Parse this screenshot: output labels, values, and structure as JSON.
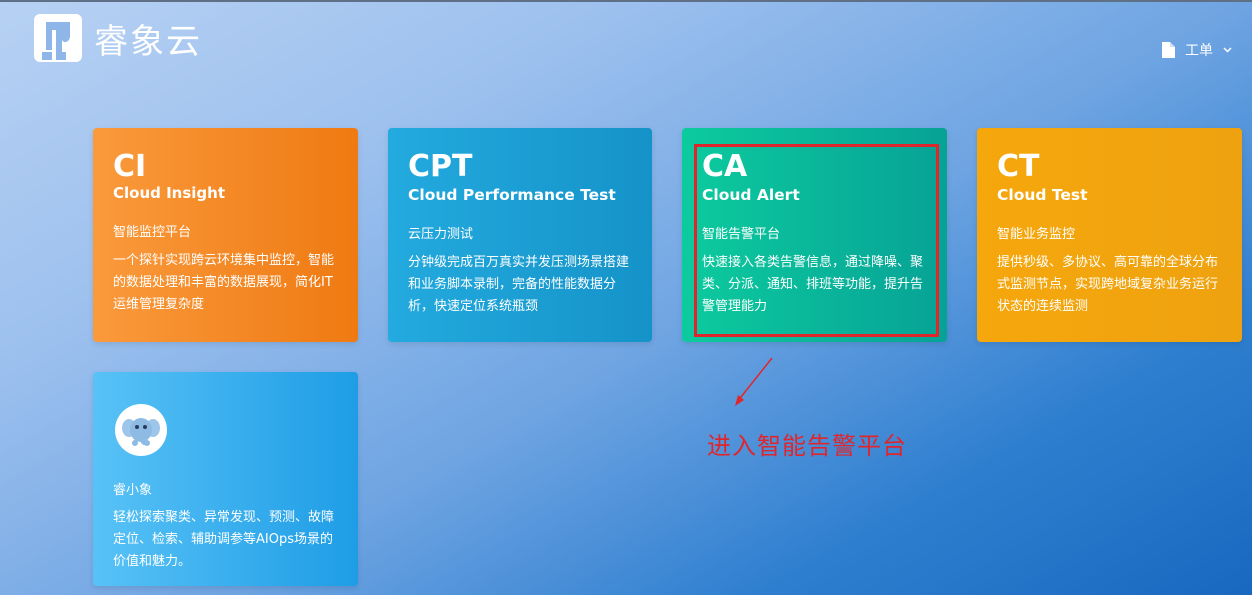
{
  "brand": {
    "name": "睿象云",
    "logo_icon": "elephant-logo-icon"
  },
  "header": {
    "workorder_label": "工单",
    "workorder_icon": "document-icon",
    "chevron_icon": "chevron-down-icon"
  },
  "cards": [
    {
      "abbr": "CI",
      "fullname": "Cloud Insight",
      "subtitle": "智能监控平台",
      "desc": "一个探针实现跨云环境集中监控，智能的数据处理和丰富的数据展现，简化IT运维管理复杂度",
      "color": "#f08a22"
    },
    {
      "abbr": "CPT",
      "fullname": "Cloud Performance Test",
      "subtitle": "云压力测试",
      "desc": "分钟级完成百万真实并发压测场景搭建和业务脚本录制，完备的性能数据分析，快速定位系统瓶颈",
      "color": "#1b9fd4"
    },
    {
      "abbr": "CA",
      "fullname": "Cloud Alert",
      "subtitle": "智能告警平台",
      "desc": "快速接入各类告警信息，通过降噪、聚类、分派、通知、排班等功能，提升告警管理能力",
      "color": "#09b79a"
    },
    {
      "abbr": "CT",
      "fullname": "Cloud Test",
      "subtitle": "智能业务监控",
      "desc": "提供秒级、多协议、高可靠的全球分布式监测节点，实现跨地域复杂业务运行状态的连续监测",
      "color": "#f2a40d"
    },
    {
      "abbr": "",
      "fullname": "",
      "subtitle": "睿小象",
      "desc": "轻松探索聚类、异常发现、预测、故障定位、检索、辅助调参等AIOps场景的价值和魅力。",
      "color": "#3aaeee",
      "avatar_icon": "elephant-mascot-icon"
    }
  ],
  "annotation": {
    "text": "进入智能告警平台",
    "color": "#e0262d"
  }
}
